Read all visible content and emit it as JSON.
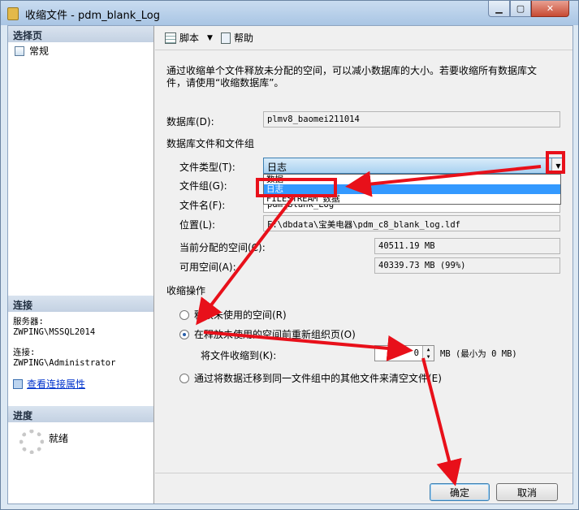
{
  "window": {
    "title": "收缩文件 - pdm_blank_Log"
  },
  "sidebar": {
    "select_page": "选择页",
    "pages": [
      {
        "label": "常规"
      }
    ],
    "connection_header": "连接",
    "server_label": "服务器:",
    "server_value": "ZWPING\\MSSQL2014",
    "conn_label": "连接:",
    "conn_value": "ZWPING\\Administrator",
    "view_props_link": "查看连接属性",
    "progress_header": "进度",
    "progress_status": "就绪"
  },
  "toolbar": {
    "script_label": "脚本",
    "help_label": "帮助"
  },
  "main": {
    "description": "通过收缩单个文件释放未分配的空间，可以减小数据库的大小。若要收缩所有数据库文件，请使用“收缩数据库”。",
    "database_label": "数据库(D):",
    "database_value": "plmv8_baomei211014",
    "files_group_title": "数据库文件和文件组",
    "file_type_label": "文件类型(T):",
    "file_type_value": "日志",
    "file_type_options": [
      "数据",
      "日志",
      "FILESTREAM 数据"
    ],
    "filegroup_label": "文件组(G):",
    "filename_label": "文件名(F):",
    "filename_value": "pdm_blank_Log",
    "location_label": "位置(L):",
    "location_value": "F:\\dbdata\\宝美电器\\pdm_c8_blank_log.ldf",
    "allocated_label": "当前分配的空间(C):",
    "allocated_value": "40511.19 MB",
    "free_label": "可用空间(A):",
    "free_value": "40339.73 MB (99%)",
    "shrink_title": "收缩操作",
    "opt_release": "释放未使用的空间(R)",
    "opt_reorganize": "在释放未使用的空间前重新组织页(O)",
    "shrink_to_label": "将文件收缩到(K):",
    "shrink_to_value": "0",
    "shrink_unit": "MB (最小为 0 MB)",
    "opt_empty": "通过将数据迁移到同一文件组中的其他文件来清空文件(E)"
  },
  "buttons": {
    "ok": "确定",
    "cancel": "取消"
  },
  "colors": {
    "annotation": "#e8101a",
    "selection": "#3399ff"
  }
}
